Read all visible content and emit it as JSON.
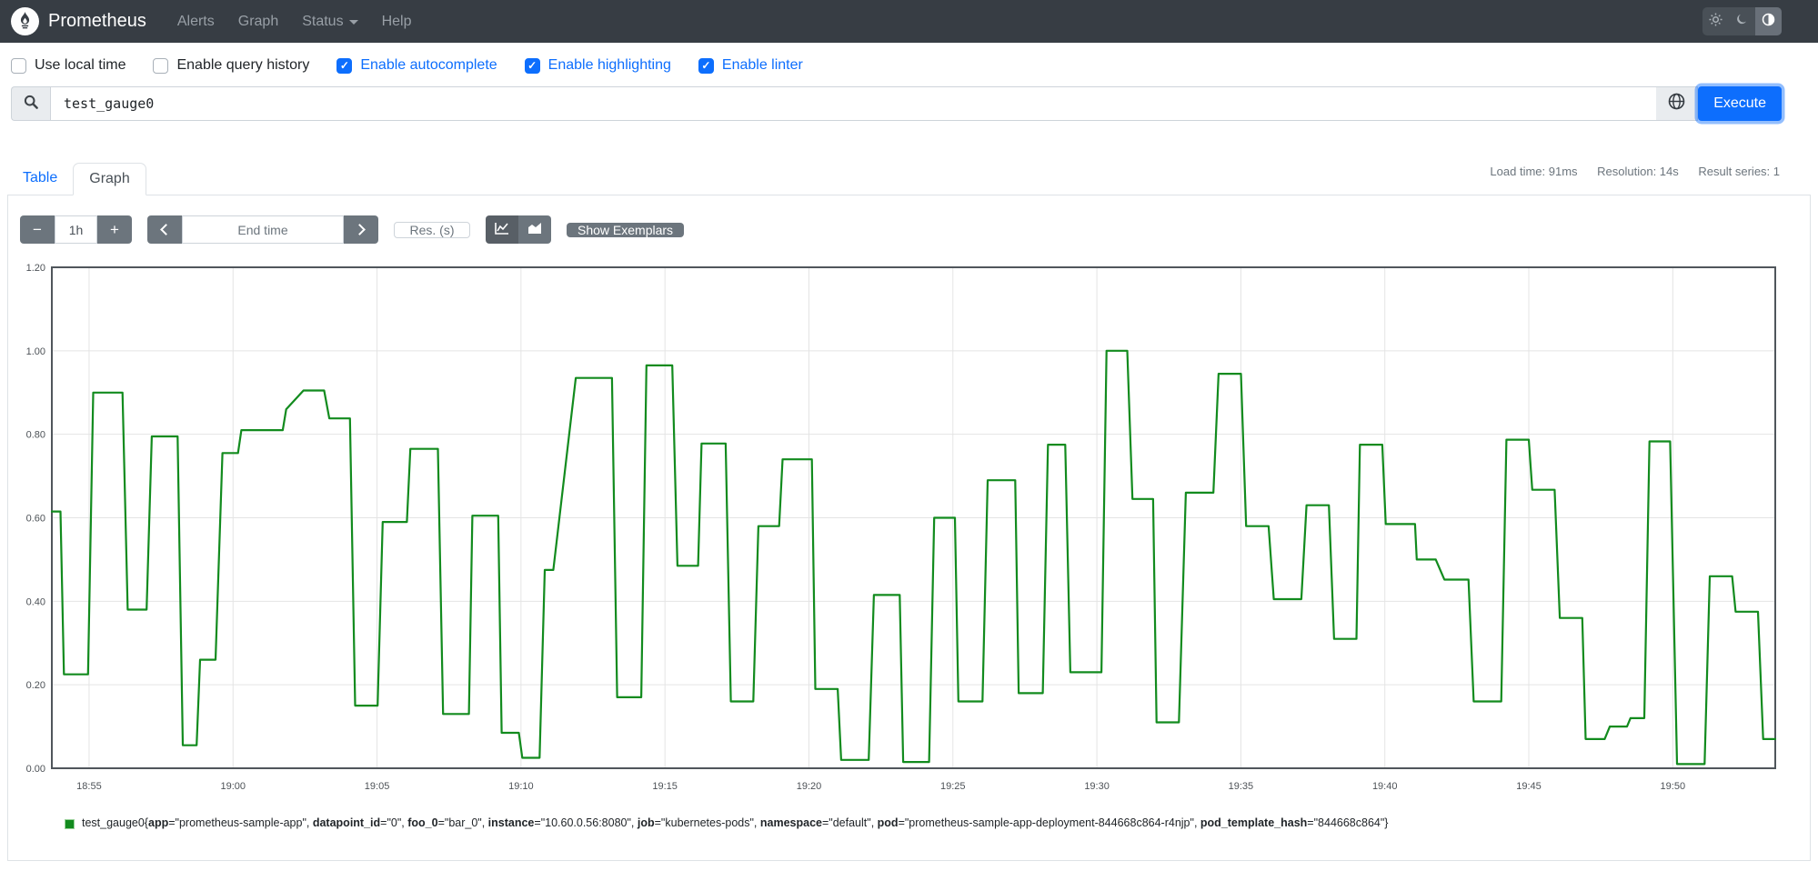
{
  "navbar": {
    "brand": "Prometheus",
    "items": [
      {
        "label": "Alerts"
      },
      {
        "label": "Graph"
      },
      {
        "label": "Status",
        "dropdown": true
      },
      {
        "label": "Help"
      }
    ],
    "theme_toggle": {
      "options": [
        "light",
        "dark",
        "auto"
      ],
      "active": "auto"
    },
    "bg_color": "#373d44"
  },
  "options": [
    {
      "label": "Use local time",
      "checked": false
    },
    {
      "label": "Enable query history",
      "checked": false
    },
    {
      "label": "Enable autocomplete",
      "checked": true
    },
    {
      "label": "Enable highlighting",
      "checked": true
    },
    {
      "label": "Enable linter",
      "checked": true
    }
  ],
  "query": {
    "value": "test_gauge0",
    "execute_label": "Execute"
  },
  "tabs": [
    {
      "label": "Table",
      "active": false
    },
    {
      "label": "Graph",
      "active": true
    }
  ],
  "stats": {
    "load_time": "Load time: 91ms",
    "resolution": "Resolution: 14s",
    "result_series": "Result series: 1"
  },
  "graph_controls": {
    "decrease_label": "−",
    "range_value": "1h",
    "increase_label": "+",
    "end_time_placeholder": "End time",
    "res_placeholder": "Res. (s)",
    "show_exemplars_label": "Show Exemplars"
  },
  "accent_color": "#0d6efd",
  "legend": {
    "metric": "test_gauge0",
    "labels": [
      [
        "app",
        "prometheus-sample-app"
      ],
      [
        "datapoint_id",
        "0"
      ],
      [
        "foo_0",
        "bar_0"
      ],
      [
        "instance",
        "10.60.0.56:8080"
      ],
      [
        "job",
        "kubernetes-pods"
      ],
      [
        "namespace",
        "default"
      ],
      [
        "pod",
        "prometheus-sample-app-deployment-844668c864-r4njp"
      ],
      [
        "pod_template_hash",
        "844668c864"
      ]
    ]
  },
  "chart_data": {
    "type": "line",
    "title": "",
    "xlabel": "",
    "ylabel": "",
    "grid": true,
    "legend_position": "bottom",
    "ylim": [
      0,
      1.2
    ],
    "y_ticks": [
      0,
      0.2,
      0.4,
      0.6,
      0.8,
      1.0,
      1.2
    ],
    "x_ticks": [
      "18:55",
      "19:00",
      "19:05",
      "19:10",
      "19:15",
      "19:20",
      "19:25",
      "19:30",
      "19:35",
      "19:40",
      "19:45",
      "19:50"
    ],
    "x_tick_start_frac": 0.0216,
    "x_tick_step_frac": 0.08354,
    "series": [
      {
        "name": "test_gauge0",
        "color": "#128b1e",
        "points": [
          [
            0.0,
            0.615
          ],
          [
            0.005,
            0.615
          ],
          [
            0.007,
            0.225
          ],
          [
            0.021,
            0.225
          ],
          [
            0.024,
            0.9
          ],
          [
            0.041,
            0.9
          ],
          [
            0.044,
            0.38
          ],
          [
            0.055,
            0.38
          ],
          [
            0.058,
            0.795
          ],
          [
            0.073,
            0.795
          ],
          [
            0.076,
            0.055
          ],
          [
            0.084,
            0.055
          ],
          [
            0.086,
            0.26
          ],
          [
            0.095,
            0.26
          ],
          [
            0.099,
            0.755
          ],
          [
            0.108,
            0.755
          ],
          [
            0.11,
            0.81
          ],
          [
            0.134,
            0.81
          ],
          [
            0.136,
            0.86
          ],
          [
            0.146,
            0.905
          ],
          [
            0.158,
            0.905
          ],
          [
            0.161,
            0.838
          ],
          [
            0.173,
            0.838
          ],
          [
            0.176,
            0.15
          ],
          [
            0.189,
            0.15
          ],
          [
            0.192,
            0.59
          ],
          [
            0.206,
            0.59
          ],
          [
            0.208,
            0.765
          ],
          [
            0.224,
            0.765
          ],
          [
            0.227,
            0.13
          ],
          [
            0.242,
            0.13
          ],
          [
            0.244,
            0.605
          ],
          [
            0.259,
            0.605
          ],
          [
            0.261,
            0.085
          ],
          [
            0.271,
            0.085
          ],
          [
            0.273,
            0.025
          ],
          [
            0.283,
            0.025
          ],
          [
            0.286,
            0.475
          ],
          [
            0.291,
            0.475
          ],
          [
            0.304,
            0.935
          ],
          [
            0.325,
            0.935
          ],
          [
            0.328,
            0.17
          ],
          [
            0.342,
            0.17
          ],
          [
            0.345,
            0.965
          ],
          [
            0.36,
            0.965
          ],
          [
            0.363,
            0.485
          ],
          [
            0.375,
            0.485
          ],
          [
            0.377,
            0.778
          ],
          [
            0.391,
            0.778
          ],
          [
            0.394,
            0.16
          ],
          [
            0.407,
            0.16
          ],
          [
            0.41,
            0.58
          ],
          [
            0.422,
            0.58
          ],
          [
            0.424,
            0.74
          ],
          [
            0.441,
            0.74
          ],
          [
            0.443,
            0.19
          ],
          [
            0.456,
            0.19
          ],
          [
            0.458,
            0.02
          ],
          [
            0.474,
            0.02
          ],
          [
            0.477,
            0.415
          ],
          [
            0.492,
            0.415
          ],
          [
            0.494,
            0.015
          ],
          [
            0.509,
            0.015
          ],
          [
            0.512,
            0.6
          ],
          [
            0.524,
            0.6
          ],
          [
            0.526,
            0.16
          ],
          [
            0.54,
            0.16
          ],
          [
            0.543,
            0.69
          ],
          [
            0.559,
            0.69
          ],
          [
            0.561,
            0.18
          ],
          [
            0.575,
            0.18
          ],
          [
            0.578,
            0.775
          ],
          [
            0.588,
            0.775
          ],
          [
            0.591,
            0.23
          ],
          [
            0.609,
            0.23
          ],
          [
            0.612,
            1.0
          ],
          [
            0.624,
            1.0
          ],
          [
            0.627,
            0.645
          ],
          [
            0.639,
            0.645
          ],
          [
            0.641,
            0.11
          ],
          [
            0.654,
            0.11
          ],
          [
            0.658,
            0.66
          ],
          [
            0.674,
            0.66
          ],
          [
            0.677,
            0.945
          ],
          [
            0.69,
            0.945
          ],
          [
            0.693,
            0.58
          ],
          [
            0.706,
            0.58
          ],
          [
            0.709,
            0.405
          ],
          [
            0.725,
            0.405
          ],
          [
            0.728,
            0.63
          ],
          [
            0.741,
            0.63
          ],
          [
            0.744,
            0.31
          ],
          [
            0.757,
            0.31
          ],
          [
            0.759,
            0.775
          ],
          [
            0.772,
            0.775
          ],
          [
            0.774,
            0.585
          ],
          [
            0.791,
            0.585
          ],
          [
            0.792,
            0.5
          ],
          [
            0.803,
            0.5
          ],
          [
            0.808,
            0.452
          ],
          [
            0.822,
            0.452
          ],
          [
            0.825,
            0.16
          ],
          [
            0.841,
            0.16
          ],
          [
            0.844,
            0.787
          ],
          [
            0.857,
            0.787
          ],
          [
            0.859,
            0.667
          ],
          [
            0.872,
            0.667
          ],
          [
            0.875,
            0.36
          ],
          [
            0.888,
            0.36
          ],
          [
            0.89,
            0.07
          ],
          [
            0.901,
            0.07
          ],
          [
            0.904,
            0.1
          ],
          [
            0.914,
            0.1
          ],
          [
            0.916,
            0.12
          ],
          [
            0.924,
            0.12
          ],
          [
            0.927,
            0.783
          ],
          [
            0.939,
            0.783
          ],
          [
            0.943,
            0.01
          ],
          [
            0.959,
            0.01
          ],
          [
            0.962,
            0.46
          ],
          [
            0.975,
            0.46
          ],
          [
            0.977,
            0.375
          ],
          [
            0.99,
            0.375
          ],
          [
            0.993,
            0.07
          ],
          [
            1.0,
            0.07
          ]
        ]
      }
    ]
  }
}
